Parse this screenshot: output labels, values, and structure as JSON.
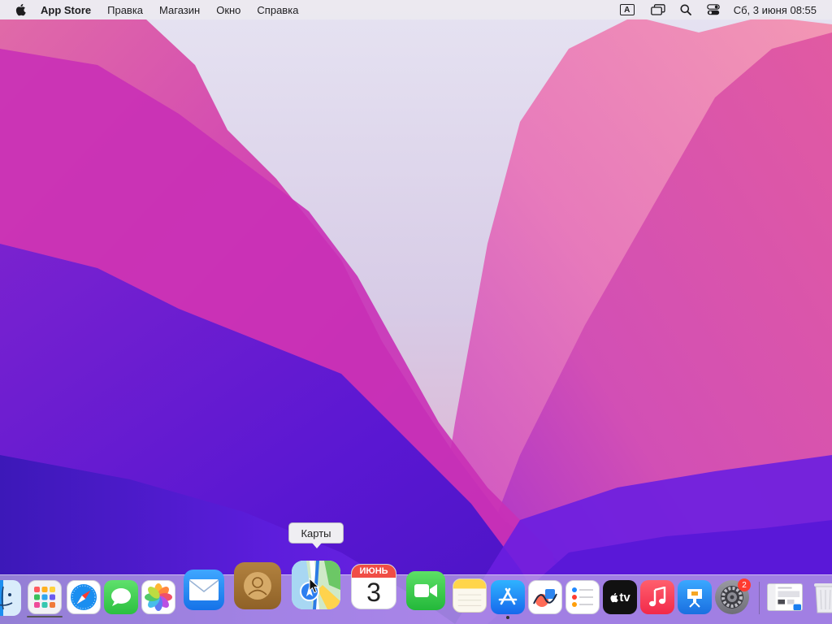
{
  "menubar": {
    "app_name": "App Store",
    "items": [
      "Правка",
      "Магазин",
      "Окно",
      "Справка"
    ],
    "keyboard_layout": "A",
    "datetime": "Сб, 3 июня  08:55",
    "icons": [
      "apple-logo-icon",
      "keyboard-layout-icon",
      "window-switcher-icon",
      "spotlight-search-icon",
      "control-center-icon"
    ]
  },
  "tooltip": {
    "text": "Карты"
  },
  "dock": {
    "apps": [
      {
        "name": "finder",
        "icon": "finder-icon"
      },
      {
        "name": "launchpad",
        "icon": "launchpad-icon"
      },
      {
        "name": "safari",
        "icon": "safari-icon"
      },
      {
        "name": "messages",
        "icon": "messages-icon"
      },
      {
        "name": "photos",
        "icon": "photos-icon"
      },
      {
        "name": "mail",
        "icon": "mail-icon"
      },
      {
        "name": "contacts",
        "icon": "contacts-icon"
      },
      {
        "name": "maps",
        "icon": "maps-icon"
      },
      {
        "name": "calendar",
        "icon": "calendar-icon"
      },
      {
        "name": "facetime",
        "icon": "facetime-icon"
      },
      {
        "name": "notes",
        "icon": "notes-icon"
      },
      {
        "name": "app-store",
        "icon": "app-store-icon"
      },
      {
        "name": "freeform",
        "icon": "freeform-icon"
      },
      {
        "name": "reminders",
        "icon": "reminders-icon"
      },
      {
        "name": "apple-tv",
        "icon": "apple-tv-icon"
      },
      {
        "name": "music",
        "icon": "music-icon"
      },
      {
        "name": "keynote",
        "icon": "keynote-icon"
      },
      {
        "name": "system-settings",
        "icon": "gear-icon"
      },
      {
        "name": "app-store-window",
        "icon": "window-thumbnail-icon"
      },
      {
        "name": "trash",
        "icon": "trash-icon"
      }
    ],
    "calendar": {
      "month": "ИЮНЬ",
      "day": "3"
    },
    "tv_label": "tv",
    "settings_badge": "2"
  },
  "colors": {
    "menubar_bg": "#ECE9F0",
    "wallpaper_purple": "#5A1FD0",
    "wallpaper_magenta": "#D63CB0",
    "wallpaper_pink": "#F06AA0",
    "badge_red": "#FF3B30"
  }
}
